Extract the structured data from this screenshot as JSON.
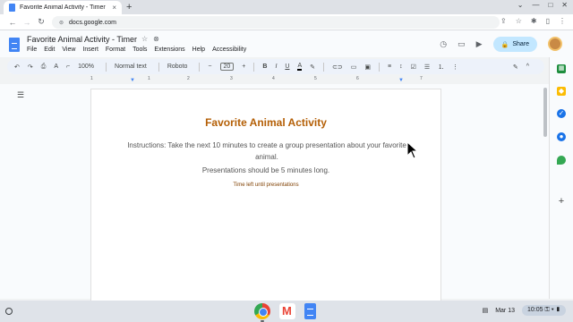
{
  "browser": {
    "tab_title": "Favorite Animal Activity - Timer",
    "tab_close": "×",
    "new_tab": "+",
    "url": "docs.google.com",
    "window_controls": [
      "⌄",
      "—",
      "□",
      "✕"
    ],
    "nav": {
      "back": "←",
      "forward": "→",
      "reload": "↻",
      "home": "⌂"
    },
    "omni_icons": [
      "⇪",
      "☆",
      "✱",
      "▯",
      "⋮"
    ]
  },
  "doc_header": {
    "title": "Favorite Animal Activity - Timer",
    "star": "☆",
    "cloud": "⊗",
    "menus": [
      "File",
      "Edit",
      "View",
      "Insert",
      "Format",
      "Tools",
      "Extensions",
      "Help",
      "Accessibility"
    ],
    "history_icon": "◷",
    "comment_icon": "▭",
    "meet_icon": "▶",
    "share_label": "Share",
    "share_icon": "🔒"
  },
  "toolbar": {
    "undo": "↶",
    "redo": "↷",
    "print": "⎙",
    "spell": "A",
    "paint": "⌐",
    "zoom": "100%",
    "style": "Normal text",
    "font": "Roboto",
    "minus": "−",
    "font_size": "20",
    "plus": "+",
    "bold": "B",
    "italic": "I",
    "underline": "U",
    "text_color": "A",
    "highlight": "✎",
    "link": "⊂⊃",
    "comment": "▭",
    "image": "▣",
    "align": "≡",
    "line_spacing": "↕",
    "checklist": "☑",
    "bullets": "☰",
    "numbered": "⒈",
    "more": "⋮",
    "edit_mode": "✎",
    "collapse": "^"
  },
  "ruler": {
    "labels": [
      "1",
      "1",
      "2",
      "3",
      "4",
      "5",
      "6",
      "7"
    ]
  },
  "document": {
    "outline_icon": "☰",
    "heading": "Favorite Animal Activity",
    "instructions": "Instructions: Take the next 10 minutes to create a group presentation about your favorite animal.",
    "length_note": "Presentations should be 5 minutes long.",
    "timer_label": "Time left until presentations"
  },
  "side_panel": {
    "icons": [
      "keep-icon",
      "tasks-icon",
      "contacts-icon",
      "maps-icon"
    ],
    "add": "+"
  },
  "taskbar": {
    "date": "Mar 13",
    "time": "10:05",
    "status_icons": [
      "⚿",
      "▾",
      "▮"
    ]
  },
  "colors": {
    "heading": "#b45f06",
    "timer": "#7f3f00",
    "share_bg": "#c2e7ff",
    "accent": "#4285f4"
  }
}
